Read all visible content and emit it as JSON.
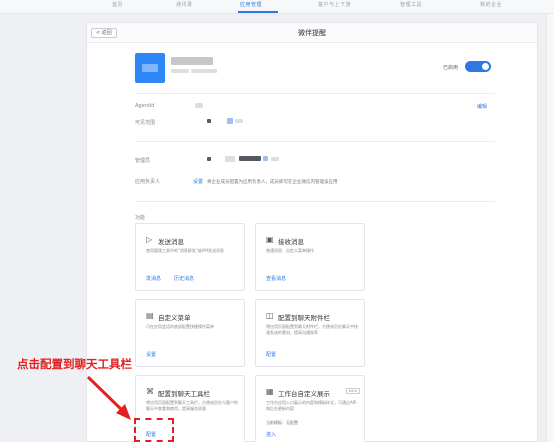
{
  "topnav": {
    "items": [
      {
        "label": "首页"
      },
      {
        "label": "通讯录"
      },
      {
        "label": "应用管理"
      },
      {
        "label": "客户与上下游"
      },
      {
        "label": "管理工具"
      },
      {
        "label": "我的企业"
      }
    ],
    "active_index": 2
  },
  "page": {
    "back_label": "< 返回",
    "title": "微伴提醒"
  },
  "app": {
    "enabled_label": "已启用",
    "enabled": true
  },
  "fields": {
    "agentid_label": "AgentId",
    "visible_range_label": "可见范围",
    "edit_label": "编辑",
    "admin_label": "管理员",
    "owner_label": "应用负责人",
    "owner_setting_link": "设置",
    "owner_hint": "将企业成员配置为应用负责人，成员即可在企业微信内管理该应用"
  },
  "functions": {
    "section_label": "功能",
    "tiles": [
      {
        "icon": "send-icon",
        "title": "发送消息",
        "desc": "使用管理工具中的\"消息群发\"或API发送消息",
        "links": [
          "发消息",
          "历史消息"
        ]
      },
      {
        "icon": "receive-icon",
        "title": "接收消息",
        "desc": "普通消息、自定义菜单操作",
        "links": [
          "查看消息"
        ]
      },
      {
        "icon": "menu-icon",
        "title": "自定义菜单",
        "desc": "可在应用会话的底部配置快捷操作菜单",
        "links": [
          "设置"
        ]
      },
      {
        "icon": "attachment-icon",
        "title": "配置到聊天附件栏",
        "desc": "将应用页面配置到聊天附件栏，方便成员在聊天中快速发送的素材，提高沟通效率",
        "links": [
          "配置"
        ]
      },
      {
        "icon": "toolbar-icon",
        "title": "配置到聊天工具栏",
        "desc": "将应用页面配置到聊天工具栏，方便成员在与客户的聊天中查看和使用，提高服务质量",
        "links": [
          "配置"
        ]
      },
      {
        "icon": "workbench-icon",
        "title": "工作台自定义展示",
        "desc": "工作台应用入口展示的内容和模板样式，可通过API和后台更新内容",
        "links": [
          "进入"
        ],
        "badge": "beta",
        "meta": "当前模板：无配置"
      }
    ]
  },
  "annotation": {
    "callout_text": "点击配置到聊天工具栏",
    "color": "#e32020"
  },
  "colors": {
    "accent": "#2e78e6",
    "app_icon": "#2f86f6"
  }
}
